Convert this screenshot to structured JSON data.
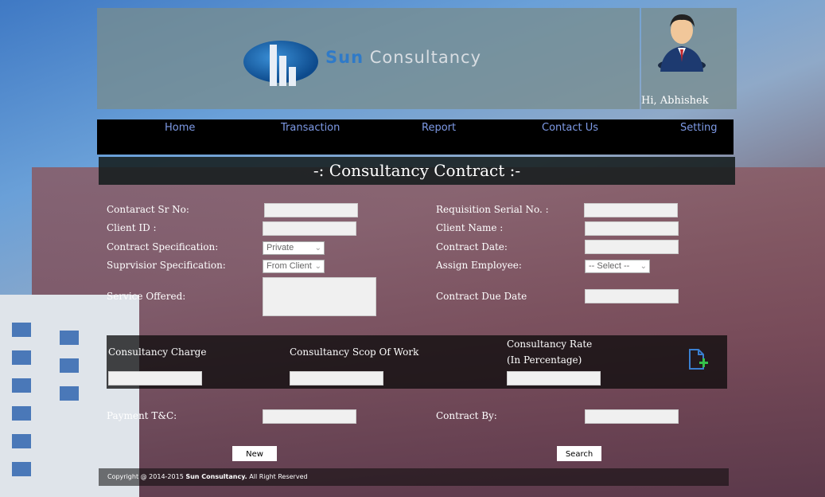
{
  "brand": {
    "name_part1": "Sun",
    "name_part2": "Consultancy"
  },
  "user": {
    "greeting": "Hi, Abhishek"
  },
  "nav": {
    "items": [
      "Home",
      "Transaction",
      "Report",
      "Contact Us",
      "Setting"
    ]
  },
  "page": {
    "title": "-: Consultancy Contract :-"
  },
  "form": {
    "contract_sr_no": {
      "label": "Contaract Sr No:",
      "value": ""
    },
    "client_id": {
      "label": "Client ID :",
      "value": ""
    },
    "contract_spec": {
      "label": "Contract Specification:",
      "selected": "Private"
    },
    "supervisor_spec": {
      "label": "Suprvisior Specification:",
      "selected": "From Client"
    },
    "service_offered": {
      "label": "Service Offered:",
      "value": ""
    },
    "requisition_serial": {
      "label": "Requisition Serial No. :",
      "value": ""
    },
    "client_name": {
      "label": "Client Name :",
      "value": ""
    },
    "contract_date": {
      "label": "Contract Date:",
      "value": ""
    },
    "assign_employee": {
      "label": "Assign Employee:",
      "selected": "-- Select --"
    },
    "contract_due_date": {
      "label": "Contract Due Date",
      "value": ""
    },
    "consultancy_charge": {
      "label": "Consultancy Charge",
      "value": ""
    },
    "scope_of_work": {
      "label": "Consultancy Scop Of Work",
      "value": ""
    },
    "rate": {
      "label_line1": "Consultancy Rate",
      "label_line2": "(In Percentage)",
      "value": ""
    },
    "payment_tc": {
      "label": "Payment T&C:",
      "value": ""
    },
    "contract_by": {
      "label": "Contract By:",
      "value": ""
    }
  },
  "buttons": {
    "new": "New",
    "search": "Search"
  },
  "footer": {
    "prefix": "Copyright @ 2014-2015 ",
    "company": "Sun Consultancy.",
    "suffix": " All Right Reserved"
  },
  "icons": {
    "avatar": "user-avatar-icon",
    "add": "add-document-icon"
  },
  "colors": {
    "nav_text": "#7e9ae6",
    "navbar_bg": "#000000",
    "brand_blue": "#2f7ac8"
  }
}
